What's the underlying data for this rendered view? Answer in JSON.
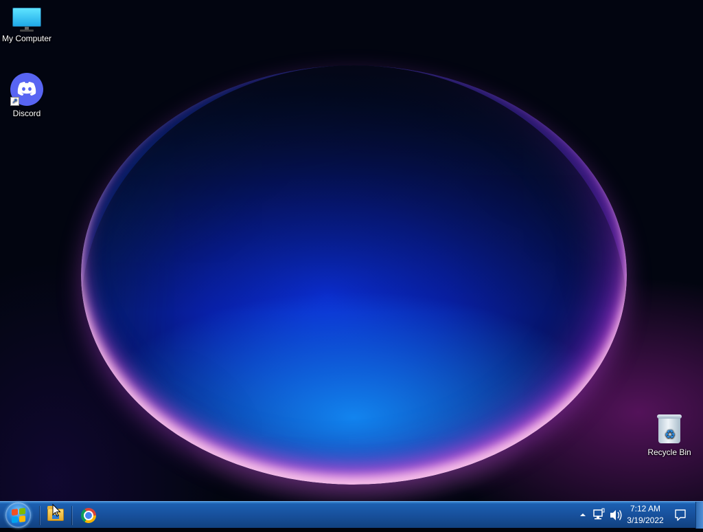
{
  "desktop": {
    "icons": [
      {
        "label": "My Computer",
        "icon": "computer-icon"
      },
      {
        "label": "Discord",
        "icon": "discord-icon",
        "shortcut": true
      },
      {
        "label": "Recycle Bin",
        "icon": "recycle-bin-icon"
      }
    ]
  },
  "taskbar": {
    "start": {
      "icon": "windows-start-icon"
    },
    "pinned": [
      {
        "name": "File Explorer",
        "icon": "file-explorer-icon"
      },
      {
        "name": "Google Chrome",
        "icon": "chrome-icon"
      }
    ],
    "tray": {
      "icons": [
        "show-hidden-icons-icon",
        "network-icon",
        "volume-icon"
      ],
      "time": "7:12 AM",
      "date": "3/19/2022",
      "notification_icon": "action-center-icon"
    }
  },
  "colors": {
    "taskbar": "#174f9a",
    "discord": "#5865f2",
    "desktop_background": "#020510"
  }
}
